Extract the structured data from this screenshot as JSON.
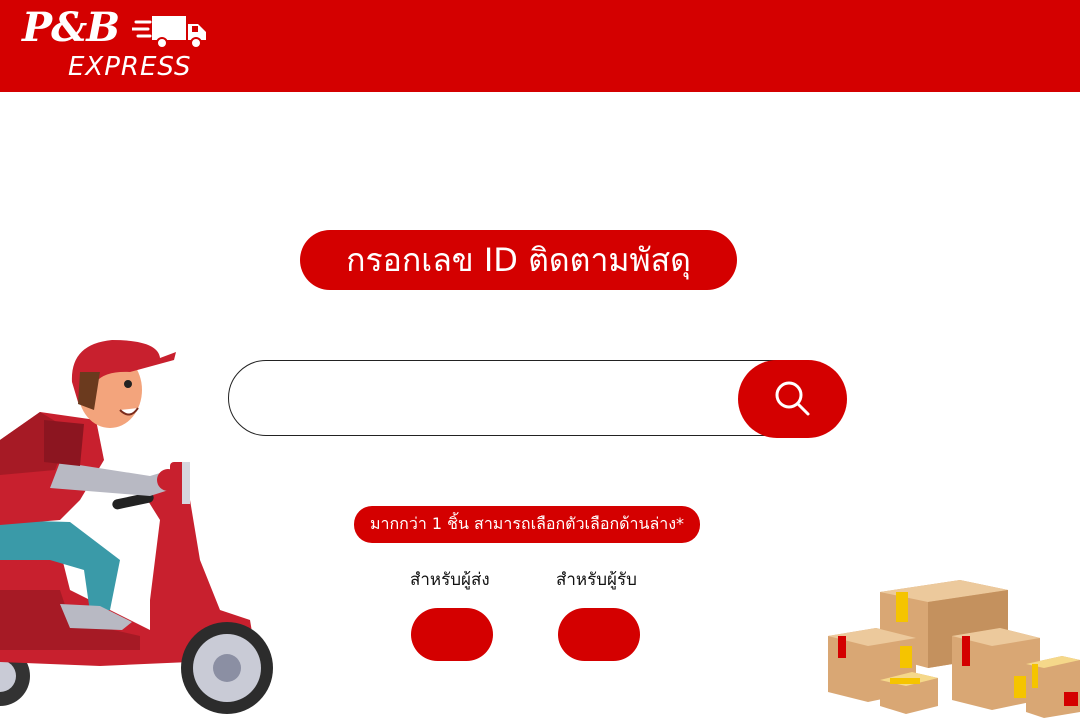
{
  "header": {
    "logo_top": "P&B",
    "logo_bottom": "EXPRESS"
  },
  "main": {
    "title": "กรอกเลข ID ติดตามพัสดุ",
    "search": {
      "placeholder": "",
      "value": ""
    },
    "note": "มากกว่า 1 ชิ้น สามารถเลือกตัวเลือกด้านล่าง*",
    "options": [
      {
        "label": "สำหรับผู้ส่ง"
      },
      {
        "label": "สำหรับผู้รับ"
      }
    ]
  },
  "colors": {
    "brand": "#d40000",
    "background": "#ffffff"
  },
  "icons": [
    "delivery-truck-icon",
    "search-icon"
  ]
}
